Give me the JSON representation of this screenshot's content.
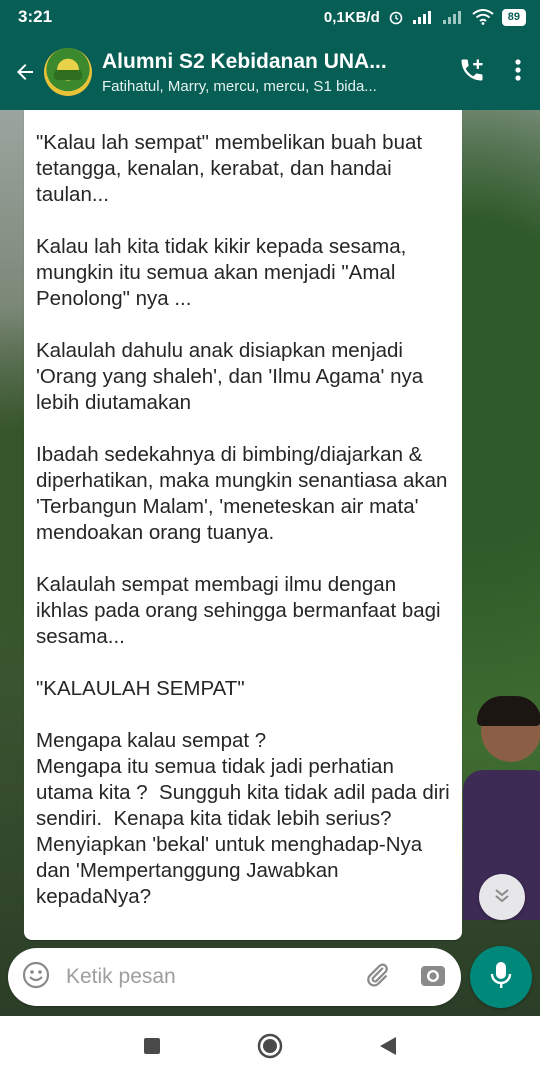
{
  "status_bar": {
    "time": "3:21",
    "network_speed": "0,1KB/d",
    "battery": "89"
  },
  "header": {
    "group_name": "Alumni S2 Kebidanan UNA...",
    "members": "Fatihatul, Marry, mercu, mercu, S1 bida..."
  },
  "message": {
    "text": "\"Kalau lah sempat\" membelikan buah buat tetangga, kenalan, kerabat, dan handai taulan...\n\nKalau lah kita tidak kikir kepada sesama, mungkin itu semua akan menjadi \"Amal Penolong\" nya ...\n\nKalaulah dahulu anak disiapkan menjadi 'Orang yang shaleh', dan 'Ilmu Agama' nya lebih diutamakan\n\nIbadah sedekahnya di bimbing/diajarkan & diperhatikan, maka mungkin senantiasa akan 'Terbangun Malam', 'meneteskan air mata' mendoakan orang tuanya.\n\nKalaulah sempat membagi ilmu dengan ikhlas pada orang sehingga bermanfaat bagi sesama...\n\n\"KALAULAH SEMPAT\"\n\nMengapa kalau sempat ?\nMengapa itu semua tidak jadi perhatian utama kita ?  Sungguh kita tidak adil pada diri sendiri.  Kenapa kita tidak lebih serius?\nMenyiapkan 'bekal' untuk menghadap-Nya dan 'Mempertanggung Jawabkan kepadaNya?"
  },
  "input": {
    "placeholder": "Ketik pesan"
  },
  "colors": {
    "primary": "#075e54",
    "accent": "#00897b",
    "bubble": "#ffffff"
  },
  "icons": [
    "back-arrow-icon",
    "group-avatar",
    "add-call-icon",
    "more-vert-icon",
    "emoji-icon",
    "attach-icon",
    "camera-icon",
    "mic-icon",
    "scroll-down-icon",
    "nav-recents-icon",
    "nav-home-icon",
    "nav-back-icon"
  ]
}
